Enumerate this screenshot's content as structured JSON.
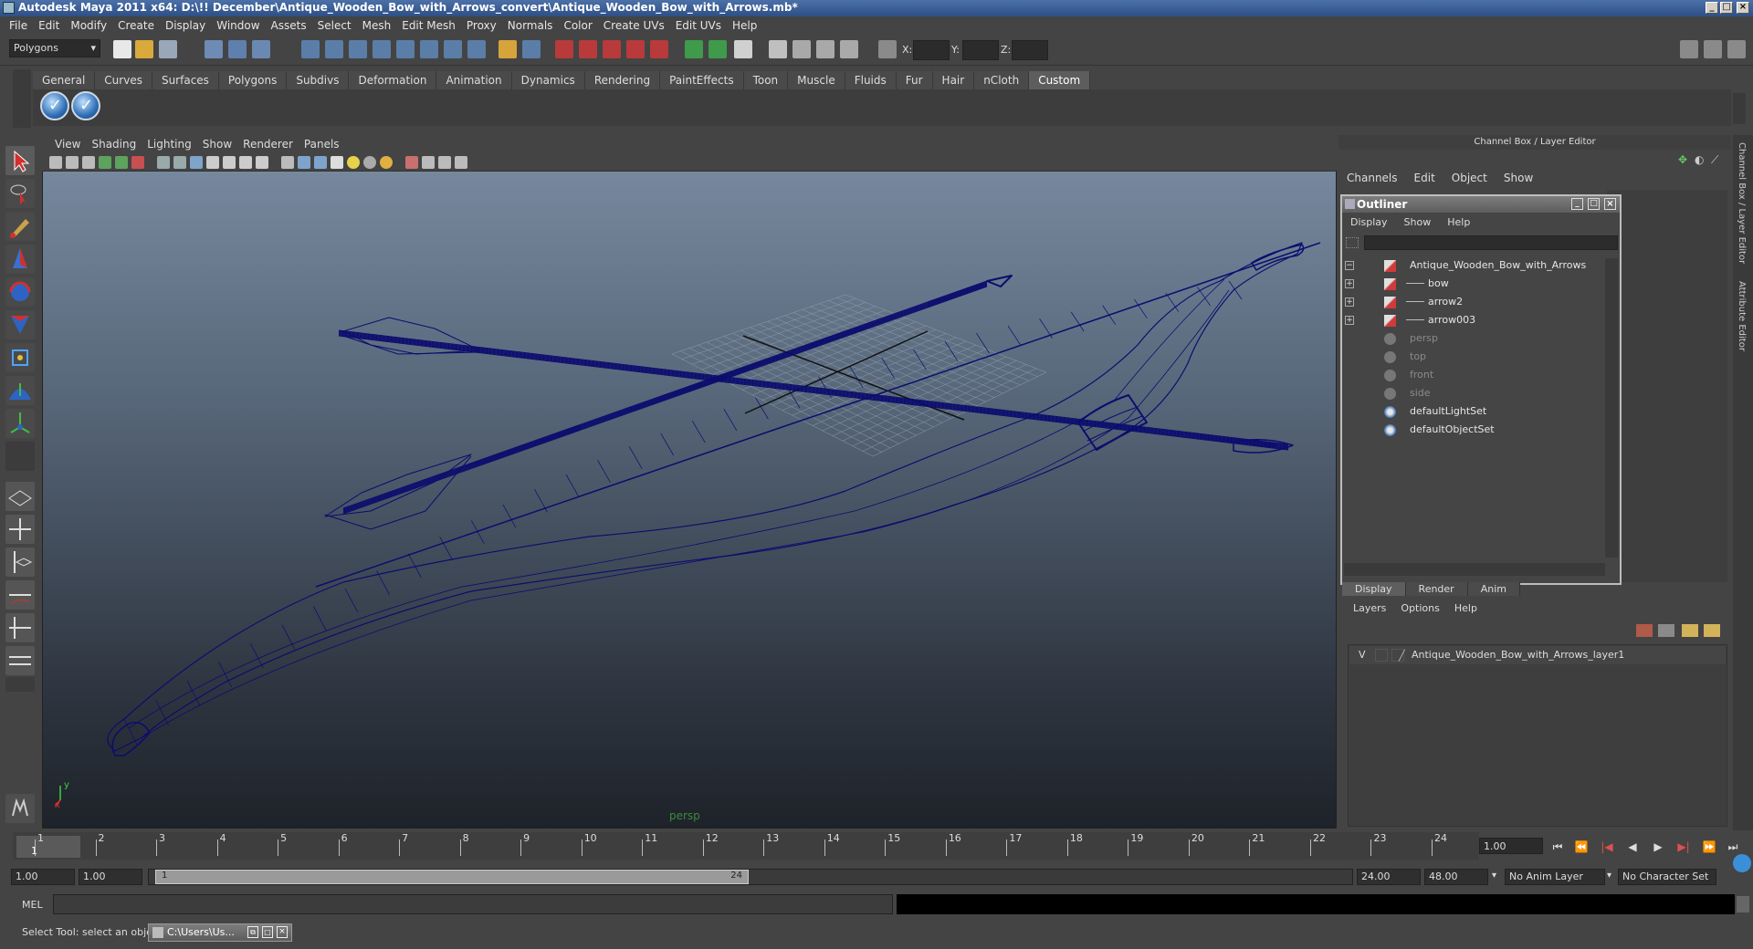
{
  "window": {
    "title": "Autodesk Maya 2011 x64: D:\\!! December\\Antique_Wooden_Bow_with_Arrows_convert\\Antique_Wooden_Bow_with_Arrows.mb*"
  },
  "menubar": [
    "File",
    "Edit",
    "Modify",
    "Create",
    "Display",
    "Window",
    "Assets",
    "Select",
    "Mesh",
    "Edit Mesh",
    "Proxy",
    "Normals",
    "Color",
    "Create UVs",
    "Edit UVs",
    "Help"
  ],
  "status_line": {
    "mode": "Polygons",
    "x_label": "X:",
    "y_label": "Y:",
    "z_label": "Z:"
  },
  "shelf": {
    "tabs": [
      "General",
      "Curves",
      "Surfaces",
      "Polygons",
      "Subdivs",
      "Deformation",
      "Animation",
      "Dynamics",
      "Rendering",
      "PaintEffects",
      "Toon",
      "Muscle",
      "Fluids",
      "Fur",
      "Hair",
      "nCloth",
      "Custom"
    ],
    "active_tab": "Custom"
  },
  "viewport": {
    "menu": [
      "View",
      "Shading",
      "Lighting",
      "Show",
      "Renderer",
      "Panels"
    ],
    "camera_label": "persp",
    "axis_x": "x",
    "axis_y": "y",
    "wire_color": "#0c0c6e"
  },
  "channel_box": {
    "header": "Channel Box / Layer Editor",
    "menu": [
      "Channels",
      "Edit",
      "Object",
      "Show"
    ],
    "side_tabs": [
      "Channel Box / Layer Editor",
      "Attribute Editor"
    ]
  },
  "outliner": {
    "title": "Outliner",
    "menu": [
      "Display",
      "Show",
      "Help"
    ],
    "items": [
      {
        "label": "Antique_Wooden_Bow_with_Arrows",
        "expander": "−",
        "dim": false
      },
      {
        "label": "bow",
        "expander": "+",
        "dim": false
      },
      {
        "label": "arrow2",
        "expander": "+",
        "dim": false
      },
      {
        "label": "arrow003",
        "expander": "+",
        "dim": false
      },
      {
        "label": "persp",
        "expander": "",
        "dim": true
      },
      {
        "label": "top",
        "expander": "",
        "dim": true
      },
      {
        "label": "front",
        "expander": "",
        "dim": true
      },
      {
        "label": "side",
        "expander": "",
        "dim": true
      },
      {
        "label": "defaultLightSet",
        "expander": "",
        "dim": false
      },
      {
        "label": "defaultObjectSet",
        "expander": "",
        "dim": false
      }
    ]
  },
  "layer_editor": {
    "tabs": [
      "Display",
      "Render",
      "Anim"
    ],
    "menu": [
      "Layers",
      "Options",
      "Help"
    ],
    "layer": {
      "visible": "V",
      "name": "Antique_Wooden_Bow_with_Arrows_layer1"
    }
  },
  "time_slider": {
    "ticks": [
      "1",
      "2",
      "3",
      "4",
      "5",
      "6",
      "7",
      "8",
      "9",
      "10",
      "11",
      "12",
      "13",
      "14",
      "15",
      "16",
      "17",
      "18",
      "19",
      "20",
      "21",
      "22",
      "23",
      "24"
    ],
    "current_frame": "1.00",
    "playhead_label": "1"
  },
  "range_slider": {
    "start_time": "1.00",
    "playback_start": "1.00",
    "thumb_start": "1",
    "thumb_end": "24",
    "playback_end": "24.00",
    "end_time": "48.00",
    "anim_layer": "No Anim Layer",
    "character_set": "No Character Set"
  },
  "command_line": {
    "label": "MEL"
  },
  "help_line": {
    "text": "Select Tool: select an object",
    "taskbar_item": "C:\\Users\\Us..."
  }
}
